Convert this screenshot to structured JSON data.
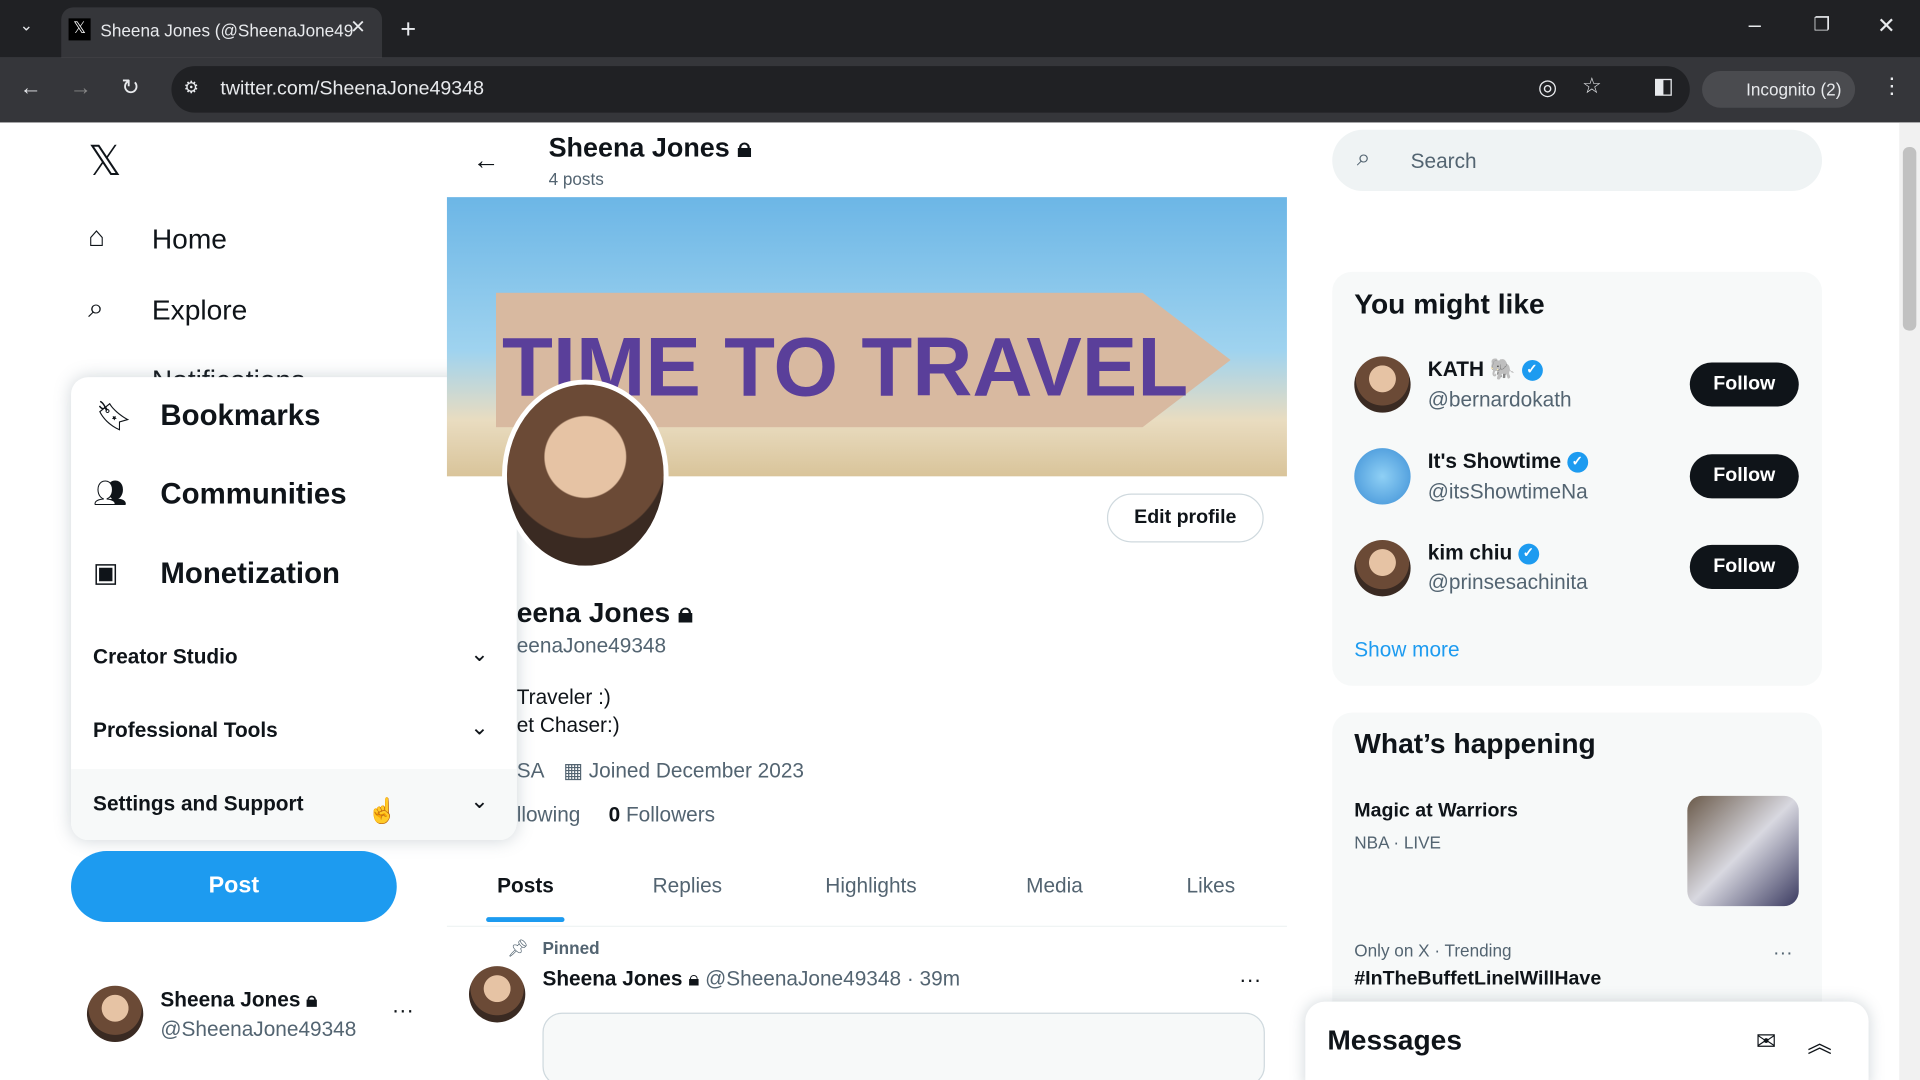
{
  "browser": {
    "tab_title": "Sheena Jones (@SheenaJone49",
    "url": "twitter.com/SheenaJone49348",
    "incognito": "Incognito (2)"
  },
  "nav": {
    "home": "Home",
    "explore": "Explore",
    "notifications": "Notifications"
  },
  "menu": {
    "items": [
      "Bookmarks",
      "Communities",
      "Monetization"
    ],
    "sections": [
      "Creator Studio",
      "Professional Tools",
      "Settings and Support"
    ]
  },
  "post_button": "Post",
  "account": {
    "name": "Sheena Jones",
    "handle": "@SheenaJone49348"
  },
  "profile": {
    "header_name": "Sheena Jones",
    "post_count": "4 posts",
    "banner_text": "TIME TO TRAVEL",
    "edit_profile": "Edit profile",
    "name_partial": "eena Jones",
    "handle_partial": "eenaJone49348",
    "bio_line1": "Traveler :)",
    "bio_line2": "et Chaser:)",
    "location_partial": "SA",
    "joined": "Joined December 2023",
    "following_partial": "llowing",
    "followers_count": "0",
    "followers_label": "Followers"
  },
  "tabs": [
    "Posts",
    "Replies",
    "Highlights",
    "Media",
    "Likes"
  ],
  "pinned": {
    "label": "Pinned",
    "name": "Sheena Jones",
    "handle": "@SheenaJone49348",
    "time": "· 39m"
  },
  "search": {
    "placeholder": "Search"
  },
  "might_like": {
    "title": "You might like",
    "users": [
      {
        "name": "KATH",
        "handle": "@bernardokath"
      },
      {
        "name": "It's Showtime",
        "handle": "@itsShowtimeNa"
      },
      {
        "name": "kim chiu",
        "handle": "@prinsesachinita"
      }
    ],
    "follow": "Follow",
    "show_more": "Show more"
  },
  "happening": {
    "title": "What’s happening",
    "items": [
      {
        "title": "Magic at Warriors",
        "meta": "NBA · LIVE"
      },
      {
        "meta": "Only on X · Trending",
        "title": "#InTheBuffetLineIWillHave"
      }
    ]
  },
  "messages": {
    "title": "Messages"
  },
  "colors": {
    "accent": "#1d9bf0",
    "text": "#0f1419"
  }
}
